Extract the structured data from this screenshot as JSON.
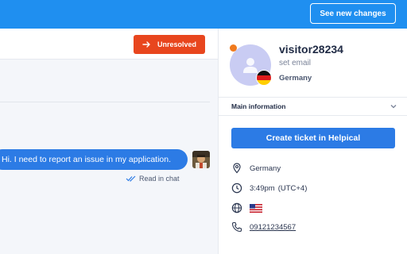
{
  "topbar": {
    "see_changes_label": "See new changes",
    "bg_color": "#1f8ff0"
  },
  "chat": {
    "status_button_label": "Unresolved",
    "status_button_color": "#e8461e",
    "message_text": "Hi. I need to report an issue in my application.",
    "read_status": "Read in chat"
  },
  "visitor": {
    "name": "visitor28234",
    "email_placeholder": "set email",
    "country": "Germany",
    "status_color": "#f07a1e"
  },
  "panel": {
    "section_title": "Main information",
    "create_ticket_label": "Create ticket in Helpical",
    "location": "Germany",
    "local_time": "3:49pm",
    "timezone": "(UTC+4)",
    "phone": "09121234567"
  },
  "icons": [
    "arrow-right-icon",
    "double-check-icon",
    "user-icon",
    "germany-flag-icon",
    "chevron-down-icon",
    "location-pin-icon",
    "clock-icon",
    "globe-icon",
    "browser-flag-icon",
    "phone-icon"
  ]
}
